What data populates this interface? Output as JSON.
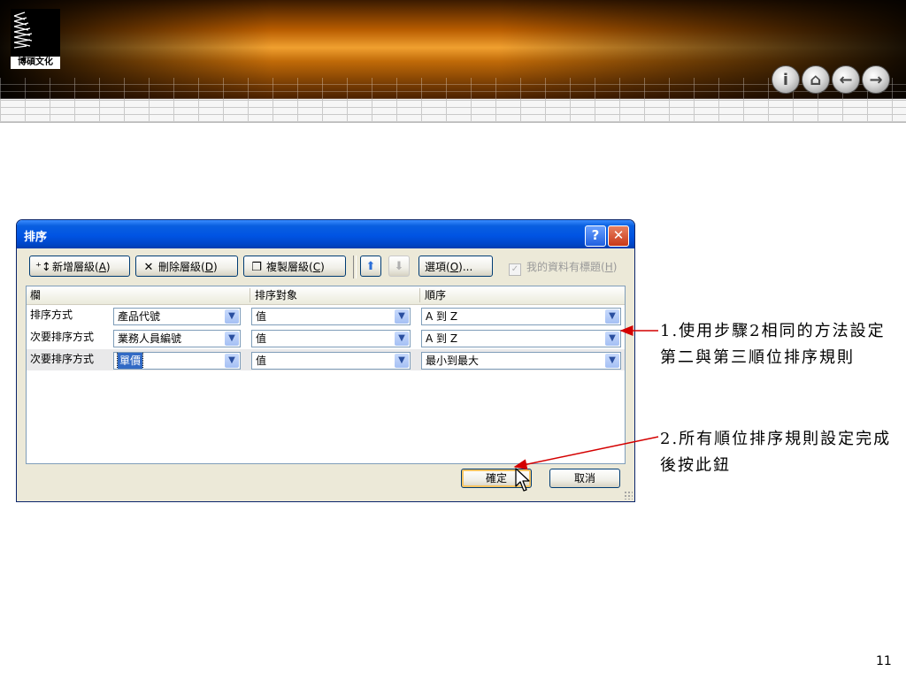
{
  "banner": {
    "logo_text": "博碩文化"
  },
  "nav_icons": [
    "info-icon",
    "home-icon",
    "back-icon",
    "forward-icon"
  ],
  "dialog": {
    "title": "排序",
    "help_button": "?",
    "close_button": "✕",
    "toolbar": {
      "add_level": {
        "text": "新增層級(",
        "key": "A",
        "end": ")"
      },
      "delete_level": {
        "text": "刪除層級(",
        "key": "D",
        "end": ")"
      },
      "copy_level": {
        "text": "複製層級(",
        "key": "C",
        "end": ")"
      },
      "options": {
        "text": "選項(",
        "key": "O",
        "end": ")..."
      },
      "header_checkbox": {
        "text": "我的資料有標題(",
        "key": "H",
        "end": ")",
        "checked": true,
        "enabled": false
      }
    },
    "grid": {
      "headers": [
        "欄",
        "排序對象",
        "順序"
      ],
      "rows": [
        {
          "label": "排序方式",
          "column": "產品代號",
          "sort_on": "值",
          "order": "A 到 Z",
          "selected": false
        },
        {
          "label": "次要排序方式",
          "column": "業務人員編號",
          "sort_on": "值",
          "order": "A 到 Z",
          "selected": false
        },
        {
          "label": "次要排序方式",
          "column": "單價",
          "sort_on": "值",
          "order": "最小到最大",
          "selected": true
        }
      ]
    },
    "ok_button": "確定",
    "cancel_button": "取消"
  },
  "annotations": {
    "note1": "1.使用步驟2相同的方法設定第二與第三順位排序規則",
    "note2": "2.所有順位排序規則設定完成後按此鈕",
    "arrow_color": "#d40000"
  },
  "page_number": "11"
}
